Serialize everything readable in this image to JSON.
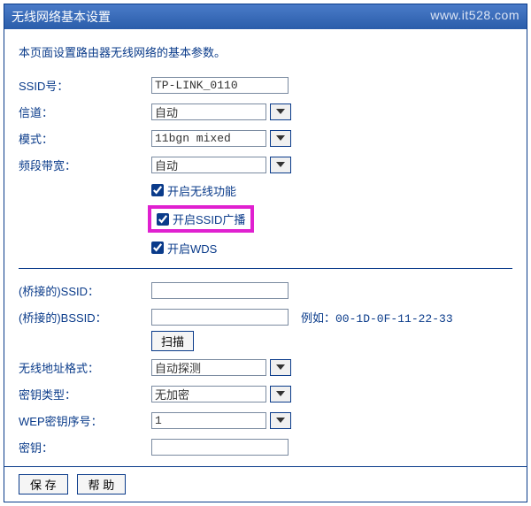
{
  "titleBar": "无线网络基本设置",
  "watermark": "www.it528.com",
  "intro": "本页面设置路由器无线网络的基本参数。",
  "fields": {
    "ssid": {
      "label": "SSID号：",
      "value": "TP-LINK_0110"
    },
    "channel": {
      "label": "信道：",
      "value": "自动"
    },
    "mode": {
      "label": "模式：",
      "value": "11bgn mixed"
    },
    "bandwidth": {
      "label": "频段带宽：",
      "value": "自动"
    },
    "bridgedSsid": {
      "label": "(桥接的)SSID：",
      "value": ""
    },
    "bridgedBssid": {
      "label": "(桥接的)BSSID：",
      "value": "",
      "example": "例如：00-1D-0F-11-22-33"
    },
    "addrFormat": {
      "label": "无线地址格式：",
      "value": "自动探测"
    },
    "encType": {
      "label": "密钥类型：",
      "value": "无加密"
    },
    "wepIndex": {
      "label": "WEP密钥序号：",
      "value": "1"
    },
    "key": {
      "label": "密钥：",
      "value": ""
    }
  },
  "checkboxes": {
    "enableWireless": {
      "label": "开启无线功能",
      "checked": true
    },
    "enableSsidBroadcast": {
      "label": "开启SSID广播",
      "checked": true
    },
    "enableWds": {
      "label": "开启WDS",
      "checked": true
    }
  },
  "buttons": {
    "scan": "扫描",
    "save": "保 存",
    "help": "帮 助"
  }
}
